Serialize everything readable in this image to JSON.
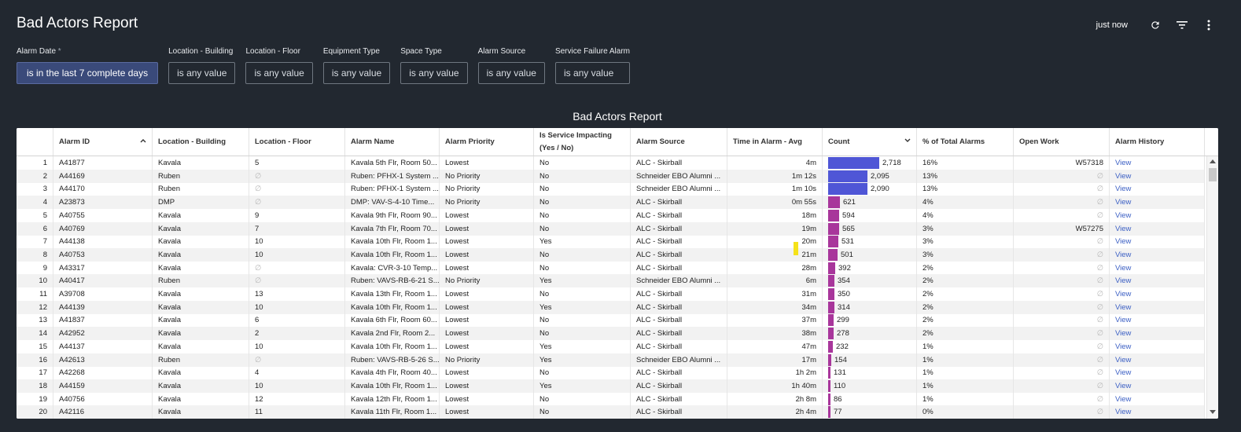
{
  "header": {
    "title": "Bad Actors Report",
    "updated": "just now",
    "icons": [
      "refresh-icon",
      "filter-icon",
      "more-vert-icon"
    ]
  },
  "filters": [
    {
      "label": "Alarm Date",
      "required_mark": "*",
      "value": "is in the last 7 complete days",
      "active": true
    },
    {
      "label": "Location - Building",
      "required_mark": "",
      "value": "is any value",
      "active": false
    },
    {
      "label": "Location - Floor",
      "required_mark": "",
      "value": "is any value",
      "active": false
    },
    {
      "label": "Equipment Type",
      "required_mark": "",
      "value": "is any value",
      "active": false
    },
    {
      "label": "Space Type",
      "required_mark": "",
      "value": "is any value",
      "active": false
    },
    {
      "label": "Alarm Source",
      "required_mark": "",
      "value": "is any value",
      "active": false
    },
    {
      "label": "Service Failure Alarm",
      "required_mark": "",
      "value": "is any value",
      "active": false
    }
  ],
  "report": {
    "title": "Bad Actors Report",
    "columns": [
      "",
      "Alarm ID",
      "Location - Building",
      "Location - Floor",
      "Alarm Name",
      "Alarm Priority",
      "Is Service Impacting (Yes / No)",
      "Alarm Source",
      "Time in Alarm - Avg",
      "Count",
      "% of Total Alarms",
      "Open Work",
      "Alarm History"
    ],
    "null_symbol": "∅",
    "count_max": 2718,
    "colors": {
      "bar_top": "#4f56d6",
      "bar_rest": "#a8369b",
      "link": "#3b5fc4",
      "highlight": "#f5e21a"
    },
    "rows": [
      [
        "1",
        "A41877",
        "Kavala",
        "5",
        "Kavala 5th Flr, Room 50...",
        "Lowest",
        "No",
        "ALC - Skirball",
        "4m",
        "2,718",
        "16%",
        "W57318",
        "View"
      ],
      [
        "2",
        "A44169",
        "Ruben",
        "∅",
        "Ruben: PFHX-1 System ...",
        "No Priority",
        "No",
        "Schneider EBO Alumni ...",
        "1m 12s",
        "2,095",
        "13%",
        "∅",
        "View"
      ],
      [
        "3",
        "A44170",
        "Ruben",
        "∅",
        "Ruben: PFHX-1 System ...",
        "No Priority",
        "No",
        "Schneider EBO Alumni ...",
        "1m 10s",
        "2,090",
        "13%",
        "∅",
        "View"
      ],
      [
        "4",
        "A23873",
        "DMP",
        "∅",
        "DMP: VAV-S-4-10 Time...",
        "No Priority",
        "No",
        "ALC - Skirball",
        "0m 55s",
        "621",
        "4%",
        "∅",
        "View"
      ],
      [
        "5",
        "A40755",
        "Kavala",
        "9",
        "Kavala 9th Flr, Room 90...",
        "Lowest",
        "No",
        "ALC - Skirball",
        "18m",
        "594",
        "4%",
        "∅",
        "View"
      ],
      [
        "6",
        "A40769",
        "Kavala",
        "7",
        "Kavala 7th Flr, Room 70...",
        "Lowest",
        "No",
        "ALC - Skirball",
        "19m",
        "565",
        "3%",
        "W57275",
        "View"
      ],
      [
        "7",
        "A44138",
        "Kavala",
        "10",
        "Kavala 10th Flr, Room 1...",
        "Lowest",
        "Yes",
        "ALC - Skirball",
        "20m",
        "531",
        "3%",
        "∅",
        "View"
      ],
      [
        "8",
        "A40753",
        "Kavala",
        "10",
        "Kavala 10th Flr, Room 1...",
        "Lowest",
        "No",
        "ALC - Skirball",
        "21m",
        "501",
        "3%",
        "∅",
        "View"
      ],
      [
        "9",
        "A43317",
        "Kavala",
        "∅",
        "Kavala: CVR-3-10 Temp...",
        "Lowest",
        "No",
        "ALC - Skirball",
        "28m",
        "392",
        "2%",
        "∅",
        "View"
      ],
      [
        "10",
        "A40417",
        "Ruben",
        "∅",
        "Ruben: VAVS-RB-6-21 S...",
        "No Priority",
        "Yes",
        "Schneider EBO Alumni ...",
        "6m",
        "354",
        "2%",
        "∅",
        "View"
      ],
      [
        "11",
        "A39708",
        "Kavala",
        "13",
        "Kavala 13th Flr, Room 1...",
        "Lowest",
        "No",
        "ALC - Skirball",
        "31m",
        "350",
        "2%",
        "∅",
        "View"
      ],
      [
        "12",
        "A44139",
        "Kavala",
        "10",
        "Kavala 10th Flr, Room 1...",
        "Lowest",
        "Yes",
        "ALC - Skirball",
        "34m",
        "314",
        "2%",
        "∅",
        "View"
      ],
      [
        "13",
        "A41837",
        "Kavala",
        "6",
        "Kavala 6th Flr, Room 60...",
        "Lowest",
        "No",
        "ALC - Skirball",
        "37m",
        "299",
        "2%",
        "∅",
        "View"
      ],
      [
        "14",
        "A42952",
        "Kavala",
        "2",
        "Kavala 2nd Flr, Room 2...",
        "Lowest",
        "No",
        "ALC - Skirball",
        "38m",
        "278",
        "2%",
        "∅",
        "View"
      ],
      [
        "15",
        "A44137",
        "Kavala",
        "10",
        "Kavala 10th Flr, Room 1...",
        "Lowest",
        "Yes",
        "ALC - Skirball",
        "47m",
        "232",
        "1%",
        "∅",
        "View"
      ],
      [
        "16",
        "A42613",
        "Ruben",
        "∅",
        "Ruben: VAVS-RB-5-26 S...",
        "No Priority",
        "Yes",
        "Schneider EBO Alumni ...",
        "17m",
        "154",
        "1%",
        "∅",
        "View"
      ],
      [
        "17",
        "A42268",
        "Kavala",
        "4",
        "Kavala 4th Flr, Room 40...",
        "Lowest",
        "No",
        "ALC - Skirball",
        "1h 2m",
        "131",
        "1%",
        "∅",
        "View"
      ],
      [
        "18",
        "A44159",
        "Kavala",
        "10",
        "Kavala 10th Flr, Room 1...",
        "Lowest",
        "Yes",
        "ALC - Skirball",
        "1h 40m",
        "110",
        "1%",
        "∅",
        "View"
      ],
      [
        "19",
        "A40756",
        "Kavala",
        "12",
        "Kavala 12th Flr, Room 1...",
        "Lowest",
        "No",
        "ALC - Skirball",
        "2h 8m",
        "86",
        "1%",
        "∅",
        "View"
      ],
      [
        "20",
        "A42116",
        "Kavala",
        "11",
        "Kavala 11th Flr, Room 1...",
        "Lowest",
        "No",
        "ALC - Skirball",
        "2h 4m",
        "77",
        "0%",
        "∅",
        "View"
      ]
    ]
  }
}
